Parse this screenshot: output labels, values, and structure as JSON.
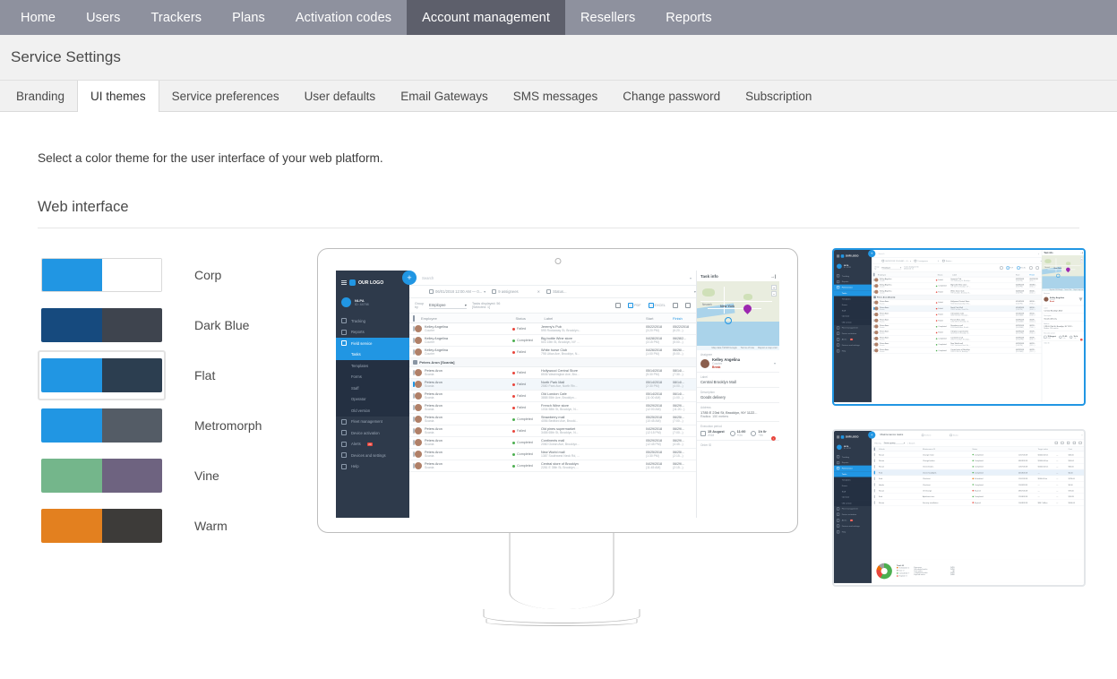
{
  "topnav": {
    "items": [
      {
        "label": "Home",
        "active": false
      },
      {
        "label": "Users",
        "active": false
      },
      {
        "label": "Trackers",
        "active": false
      },
      {
        "label": "Plans",
        "active": false
      },
      {
        "label": "Activation codes",
        "active": false
      },
      {
        "label": "Account management",
        "active": true
      },
      {
        "label": "Resellers",
        "active": false
      },
      {
        "label": "Reports",
        "active": false
      }
    ]
  },
  "page": {
    "title": "Service Settings",
    "intro": "Select a color theme for the user interface of your web platform.",
    "section_title": "Web interface"
  },
  "subtabs": {
    "items": [
      {
        "label": "Branding",
        "active": false
      },
      {
        "label": "UI themes",
        "active": true
      },
      {
        "label": "Service preferences",
        "active": false
      },
      {
        "label": "User defaults",
        "active": false
      },
      {
        "label": "Email Gateways",
        "active": false
      },
      {
        "label": "SMS messages",
        "active": false
      },
      {
        "label": "Change password",
        "active": false
      },
      {
        "label": "Subscription",
        "active": false
      }
    ]
  },
  "themes": [
    {
      "name": "Corp",
      "primary": "#2196e3",
      "secondary": "#ffffff",
      "selected": false,
      "outlined": true
    },
    {
      "name": "Dark Blue",
      "primary": "#164a7e",
      "secondary": "#3e444e",
      "selected": false,
      "outlined": false
    },
    {
      "name": "Flat",
      "primary": "#2196e3",
      "secondary": "#2c3e50",
      "selected": true,
      "outlined": false
    },
    {
      "name": "Metromorph",
      "primary": "#2196e3",
      "secondary": "#545c66",
      "selected": false,
      "outlined": false
    },
    {
      "name": "Vine",
      "primary": "#74b68b",
      "secondary": "#6e6380",
      "selected": false,
      "outlined": false
    },
    {
      "name": "Warm",
      "primary": "#e3801f",
      "secondary": "#3d3b39",
      "selected": false,
      "outlined": false
    }
  ],
  "preview": {
    "logo": "OUR LOGO",
    "user": {
      "name": "NLPA",
      "id": "ID: 44798"
    },
    "nav": [
      {
        "label": "Tracking",
        "type": "top",
        "active": false
      },
      {
        "label": "Reports",
        "type": "top",
        "active": false
      },
      {
        "label": "Field service",
        "type": "top",
        "active": true
      },
      {
        "label": "Tasks",
        "type": "sub",
        "active": true
      },
      {
        "label": "Templates",
        "type": "sub",
        "active": false
      },
      {
        "label": "Forms",
        "type": "sub",
        "active": false
      },
      {
        "label": "Staff",
        "type": "sub",
        "active": false
      },
      {
        "label": "Operator",
        "type": "sub",
        "active": false
      },
      {
        "label": "Old version",
        "type": "sub",
        "active": false
      },
      {
        "label": "Fleet management",
        "type": "top",
        "active": false
      },
      {
        "label": "Device activation",
        "type": "top",
        "active": false
      },
      {
        "label": "Alerts",
        "type": "top",
        "active": false,
        "badge": "20"
      },
      {
        "label": "Devices and settings",
        "type": "top",
        "active": false
      },
      {
        "label": "Help",
        "type": "top",
        "active": false
      }
    ],
    "search_placeholder": "Search",
    "filters": {
      "date_range": "06/01/2018 12:00 AM — 0...",
      "assignees": "9 assignees",
      "status": "Status..."
    },
    "toolbar": {
      "group_by_label": "Group by",
      "group_by_value": "Employee",
      "tasks_displayed": "Tasks displayed: 56",
      "selected": "[Selected: 1]",
      "pdf": "PDF",
      "excel": "EXCEL"
    },
    "columns": [
      "Employee",
      "Status",
      "Label",
      "Start",
      "Finish"
    ],
    "rows": [
      {
        "group": null,
        "name": "Kelley Angelina",
        "role": "Courier",
        "status": "Failed",
        "state": "red",
        "label": "Jeremy's Pub",
        "address": "595 Rockaway St, Brooklyn...",
        "start": "05/22/2018",
        "start_t": "(3:20 PM)",
        "finish": "05/22/2018",
        "finish_t": "(6:20...)",
        "checked": false
      },
      {
        "group": null,
        "name": "Kelley Angelina",
        "role": "Courier",
        "status": "Completed",
        "state": "green",
        "label": "Big bottle Wine store",
        "address": "503 15th St, Brooklyn, NY ...",
        "start": "04/28/2018",
        "start_t": "(3:15 PM)",
        "finish": "06/28/2...",
        "finish_t": "(5:00...)",
        "checked": false
      },
      {
        "group": null,
        "name": "Kelley Angelina",
        "role": "Courier",
        "status": "Failed",
        "state": "red",
        "label": "White horse Club",
        "address": "798 Utica Ave, Brooklyn, N...",
        "start": "04/26/2018",
        "start_t": "(1:00 PM)",
        "finish": "06/26/...",
        "finish_t": "(5:00...)",
        "checked": false
      },
      {
        "group": "Peters Aron [Scania]",
        "name": null
      },
      {
        "group": null,
        "name": "Peters Aron",
        "role": "Scania",
        "status": "Failed",
        "state": "red",
        "label": "Hollywood Central Store",
        "address": "8536 Washington Ave, Bro...",
        "start": "05/14/2018",
        "start_t": "(5:30 PM)",
        "finish": "08/14/...",
        "finish_t": "(7:30...)",
        "checked": false
      },
      {
        "group": null,
        "name": "Peters Aron",
        "role": "Scania",
        "status": "Failed",
        "state": "red",
        "label": "North Park Mall",
        "address": "2580 Park Ave, North Riv...",
        "start": "05/14/2018",
        "start_t": "(2:30 PM)",
        "finish": "08/14/...",
        "finish_t": "(4:00...)",
        "checked": true
      },
      {
        "group": null,
        "name": "Peters Aron",
        "role": "Scania",
        "status": "Failed",
        "state": "red",
        "label": "Old London Cafe",
        "address": "3888 55th Ave, Brooklyn...",
        "start": "05/14/2018",
        "start_t": "(11:00 AM)",
        "finish": "06/14/...",
        "finish_t": "(1:00...)",
        "checked": false
      },
      {
        "group": null,
        "name": "Peters Aron",
        "role": "Scania",
        "status": "Failed",
        "state": "red",
        "label": "French Wine store",
        "address": "1034 58th St, Brooklyn, N...",
        "start": "05/29/2018",
        "start_t": "(12:00 AM)",
        "finish": "06/29/...",
        "finish_t": "(11:20...)",
        "checked": false
      },
      {
        "group": null,
        "name": "Peters Aron",
        "role": "Scania",
        "status": "Completed",
        "state": "green",
        "label": "Strawberry mall",
        "address": "4056 Bedford Ave, Brookl...",
        "start": "05/25/2018",
        "start_t": "(10:45 AM)",
        "finish": "06/25/...",
        "finish_t": "(7:00...)",
        "checked": false
      },
      {
        "group": null,
        "name": "Peters Aron",
        "role": "Scania",
        "status": "Failed",
        "state": "red",
        "label": "Old pines supermarket",
        "address": "3458 65th St, Brooklyn, N...",
        "start": "04/29/2018",
        "start_t": "(12:15 PM)",
        "finish": "06/29/...",
        "finish_t": "(7:00...)",
        "checked": false
      },
      {
        "group": null,
        "name": "Peters Aron",
        "role": "Scania",
        "status": "Completed",
        "state": "green",
        "label": "Continents mall",
        "address": "2060 Ocean Ave, Brooklyn...",
        "start": "05/29/2018",
        "start_t": "(12:45 PM)",
        "finish": "06/29/...",
        "finish_t": "(4:45...)",
        "checked": false
      },
      {
        "group": null,
        "name": "Peters Aron",
        "role": "Scania",
        "status": "Completed",
        "state": "green",
        "label": "New World mall",
        "address": "1387 Southwest Neck Rd, ...",
        "start": "05/25/2018",
        "start_t": "(1:30 PM)",
        "finish": "06/25/...",
        "finish_t": "(2:15...)",
        "checked": false
      },
      {
        "group": null,
        "name": "Peters Aron",
        "role": "Scania",
        "status": "Completed",
        "state": "green",
        "label": "Central store of Brooklyn",
        "address": "2281 E 35th St, Brooklyn, ...",
        "start": "04/29/2018",
        "start_t": "(11:45 AM)",
        "finish": "06/29/...",
        "finish_t": "(2:15...)",
        "checked": false
      }
    ],
    "task_info": {
      "title": "Task info",
      "assignee_label": "Assignee",
      "assignee_name": "Kelley Angelina",
      "assignee_role": "Courier",
      "assignee_state": "Break",
      "label_label": "Label",
      "label_value": "Central Brooklyn Mall",
      "description_label": "Description",
      "description_value": "Goods delivery",
      "address_label": "Address",
      "address_value": "1785 E 23rd St, Brooklyn, NY 1122...",
      "radius_value": "Radius: 150 meters",
      "execution_label": "Execution period",
      "date": "15 August",
      "year": "2018",
      "time": "11:00",
      "time_sub": "+On",
      "duration": "1h 0r",
      "duration_sub": "~5h",
      "alert": "!",
      "order_label": "Order ID"
    },
    "map": {
      "city": "New York",
      "city2": "Newark",
      "attribution": "Map data ©2018 Google",
      "terms": "Terms of Use",
      "report": "Report a map error"
    }
  },
  "thumbnails": [
    {
      "name": "tasks-theme-preview",
      "selected": true
    },
    {
      "name": "maintenance-theme-preview",
      "selected": false
    }
  ],
  "maintenance": {
    "title": "Maintenance tasks",
    "vehicle": "Vehicle",
    "status": "Status",
    "filter_label": "Filter by",
    "filter_value": "Device group",
    "search": "Search",
    "columns": [
      "Vehicle",
      "Maintenance",
      "Status",
      "Target value",
      "Cost"
    ],
    "rows": [
      {
        "a": "Nissan",
        "b": "Change motor",
        "c": "Completed",
        "state": "green",
        "d": "12/07/2018",
        "e": "$1000.00 km",
        "f": "—",
        "g": "$40.00",
        "sel": false
      },
      {
        "a": "Nissan",
        "b": "Change brakes",
        "c": "Completed",
        "state": "green",
        "d": "08/09/2018",
        "e": "$1000.00 km",
        "f": "—",
        "g": "$50.64",
        "sel": false
      },
      {
        "a": "Nissan",
        "b": "Check brakes",
        "c": "Completed",
        "state": "green",
        "d": "10/07/2018",
        "e": "$1000.00 km",
        "f": "—",
        "g": "$60.00",
        "sel": false
      },
      {
        "a": "Ford",
        "b": "Check headlights",
        "c": "Completed",
        "state": "green",
        "d": "04/08/2018",
        "e": "—",
        "f": "—",
        "g": "$0.00",
        "sel": true
      },
      {
        "a": "Ford",
        "b": "Checkout",
        "c": "Scheduled",
        "state": "orange",
        "d": "12/01/2018",
        "e": "$500.00 km",
        "f": "—",
        "g": "$120.00",
        "sel": false
      },
      {
        "a": "Honda",
        "b": "Checkout",
        "c": "Completed",
        "state": "green",
        "d": "11/08/2018",
        "e": "—",
        "f": "—",
        "g": "$0.00",
        "sel": false
      },
      {
        "a": "Nissan",
        "b": "Oil Change",
        "c": "Expired",
        "state": "red",
        "d": "08/07/2018",
        "e": "—",
        "f": "—",
        "g": "$75.00",
        "sel": false
      },
      {
        "a": "Ford",
        "b": "Aphthoeic tires",
        "c": "Completed",
        "state": "green",
        "d": "12/08/2018",
        "e": "—",
        "f": "—",
        "g": "$24.99",
        "sel": false
      },
      {
        "a": "Nissan",
        "b": "Security installation",
        "c": "Expired",
        "state": "red",
        "d": "10/08/2018",
        "e": "$86.7 dillion",
        "f": "—",
        "g": "$500.64",
        "sel": false
      }
    ],
    "chart_title": "Total: 63",
    "legend": [
      {
        "label": "Scheduled: 2",
        "color": "#ef6c00"
      },
      {
        "label": "Due: 0",
        "color": "#9e9e9e"
      },
      {
        "label": "Completed: 7",
        "color": "#4caf50"
      },
      {
        "label": "Expired: 3",
        "color": "#e8453c"
      }
    ],
    "stats": [
      {
        "k": "Expenses",
        "v": "$455"
      },
      {
        "k": "Scheduled works",
        "v": "$450"
      },
      {
        "k": "Due works",
        "v": "$0"
      },
      {
        "k": "Completed works",
        "v": "$285"
      },
      {
        "k": "Expired works",
        "v": "$480"
      }
    ]
  },
  "colors": {
    "topnav_bg": "#8e919e",
    "topnav_active": "#5d5f6b",
    "accent": "#2196e3",
    "band_bg": "#f1f1f1"
  }
}
